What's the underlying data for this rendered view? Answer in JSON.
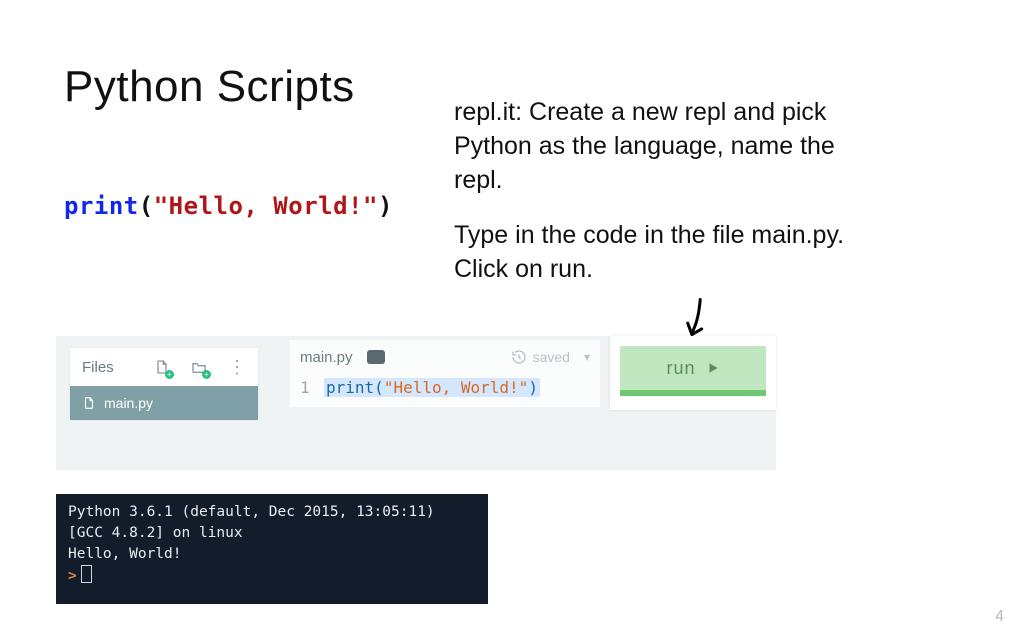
{
  "title": "Python Scripts",
  "instructions": {
    "p1": "repl.it: Create a new repl and pick Python as the language, name the repl.",
    "p2": "Type in the code in the file main.py. Click on run."
  },
  "sample_code": {
    "fn": "print",
    "open": "(",
    "str": "\"Hello, World!\"",
    "close": ")"
  },
  "files_panel": {
    "header": "Files",
    "active_file": "main.py"
  },
  "editor": {
    "tab": "main.py",
    "saved_label": "saved",
    "line_number": "1",
    "code": {
      "fn": "print",
      "open": "(",
      "str": "\"Hello, World!\"",
      "close": ")"
    }
  },
  "run": {
    "label": "run"
  },
  "terminal": {
    "line1": "Python 3.6.1 (default, Dec 2015, 13:05:11)",
    "line2": "[GCC 4.8.2] on linux",
    "line3": "Hello, World!",
    "prompt": ">"
  },
  "page_number": "4"
}
